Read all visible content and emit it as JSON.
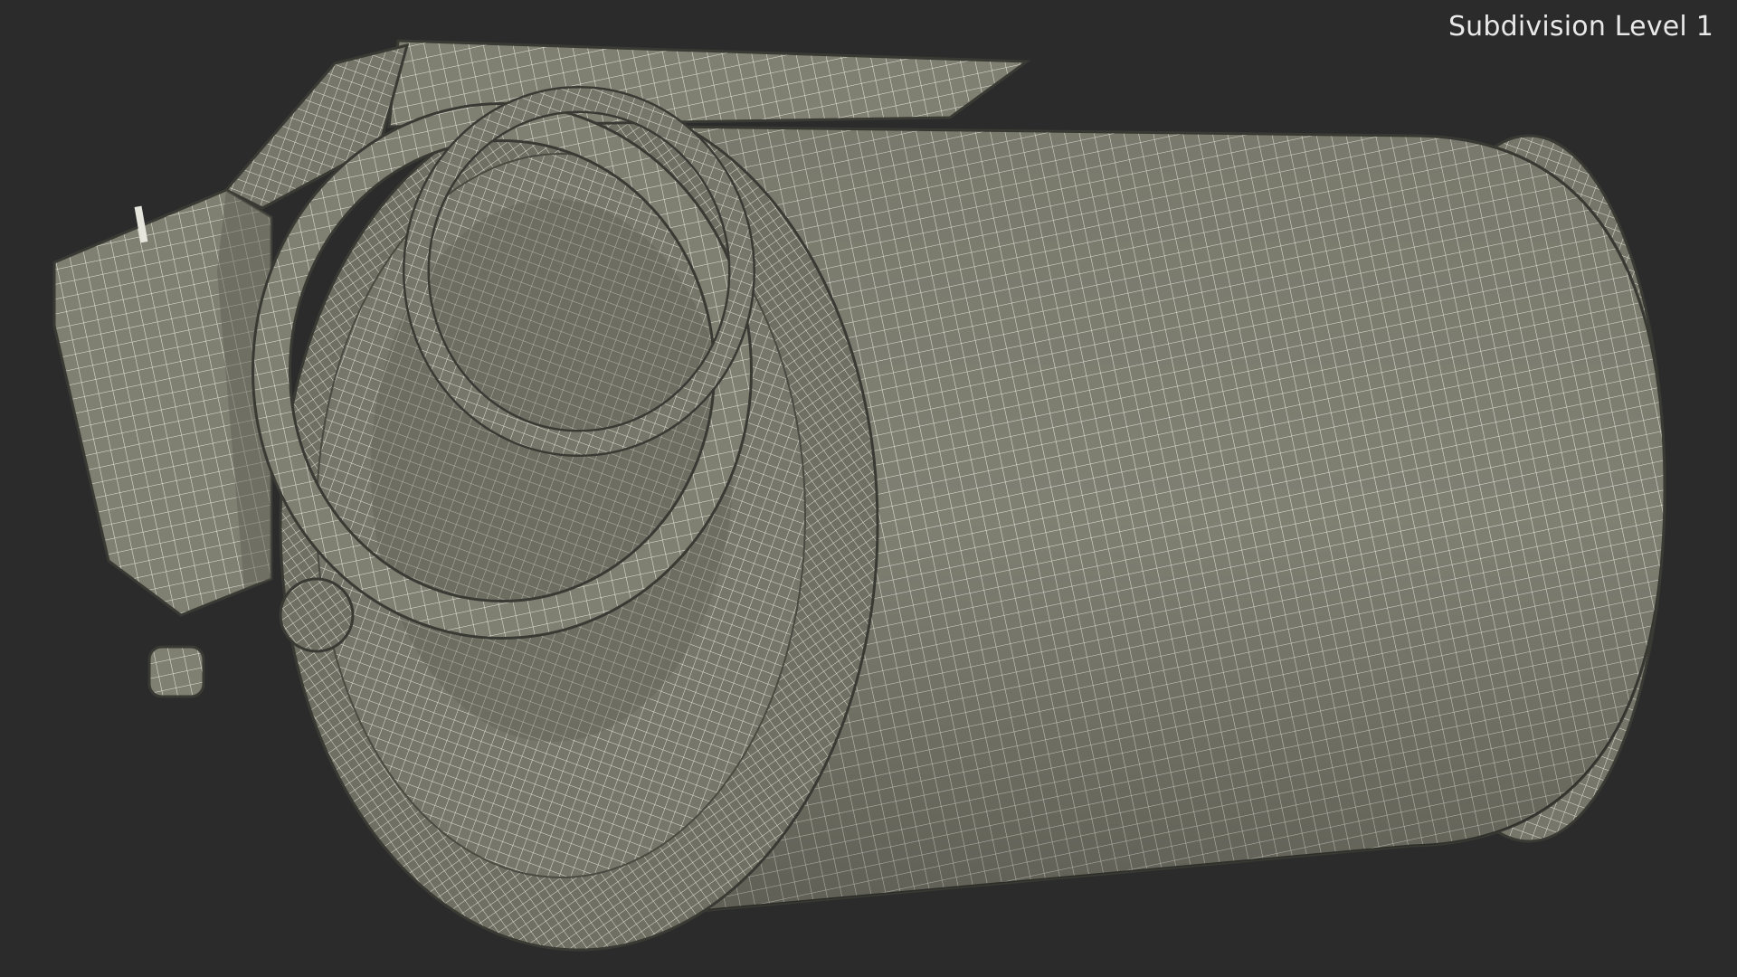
{
  "overlay": {
    "subdivision_label": "Subdivision Level 1"
  },
  "colors": {
    "background": "#2b2b2b",
    "surface": "#7f7f72",
    "wire": "#e6e6dc",
    "label": "#e8e8e8"
  }
}
